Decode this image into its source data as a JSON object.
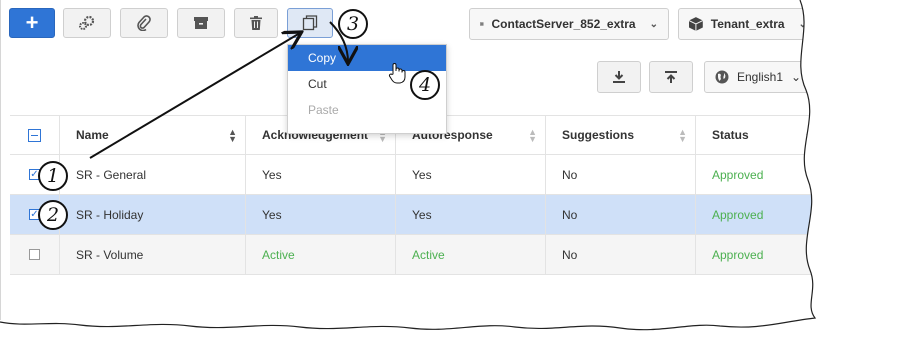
{
  "toolbar": {
    "add_label": "+",
    "buttons": [
      "add-button",
      "settings-button",
      "attach-button",
      "archive-button",
      "delete-button",
      "copy-paste-button"
    ]
  },
  "selectors": {
    "contact_server": "ContactServer_852_extra",
    "tenant": "Tenant_extra",
    "language": "English1"
  },
  "copy_menu": {
    "items": [
      {
        "label": "Copy",
        "state": "highlighted"
      },
      {
        "label": "Cut",
        "state": "enabled"
      },
      {
        "label": "Paste",
        "state": "disabled"
      }
    ]
  },
  "table": {
    "columns": [
      "Name",
      "Acknowledgement",
      "Autoresponse",
      "Suggestions",
      "Status"
    ],
    "rows": [
      {
        "checked": true,
        "selected": false,
        "name": "SR - General",
        "acknowledgement": "Yes",
        "autoresponse": "Yes",
        "suggestions": "No",
        "status": "Approved"
      },
      {
        "checked": true,
        "selected": true,
        "name": "SR - Holiday",
        "acknowledgement": "Yes",
        "autoresponse": "Yes",
        "suggestions": "No",
        "status": "Approved"
      },
      {
        "checked": false,
        "selected": false,
        "name": "SR - Volume",
        "acknowledgement": "Active",
        "autoresponse": "Active",
        "suggestions": "No",
        "status": "Approved"
      }
    ]
  },
  "callouts": [
    "1",
    "2",
    "3",
    "4"
  ],
  "colors": {
    "accent": "#2f75d6",
    "selected_row": "#cfe0f8",
    "status_green": "#4cb050"
  }
}
